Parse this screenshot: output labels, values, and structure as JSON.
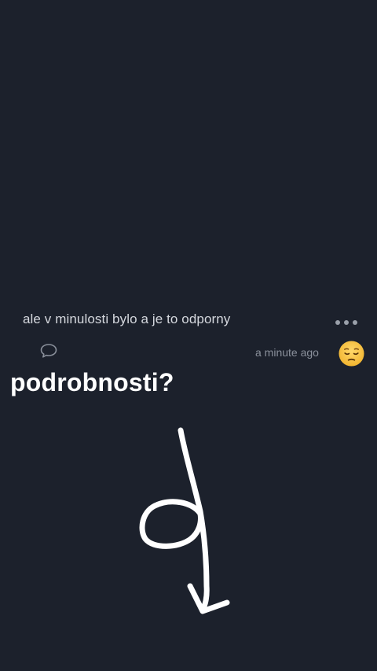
{
  "comment": {
    "text": "ale v minulosti bylo a je to odporny",
    "timestamp": "a minute ago",
    "reaction_emoji": "pensive-face",
    "reply_icon": "speech-bubble-icon",
    "more_icon": "ellipsis-icon"
  },
  "story": {
    "text": "podrobnosti?",
    "drawing": "hand-drawn-arrow-down"
  },
  "colors": {
    "background": "#1c212c",
    "comment_text": "#d5d8de",
    "muted": "#8a909b",
    "emoji_face": "#f6c443",
    "story_text": "#ffffff"
  }
}
